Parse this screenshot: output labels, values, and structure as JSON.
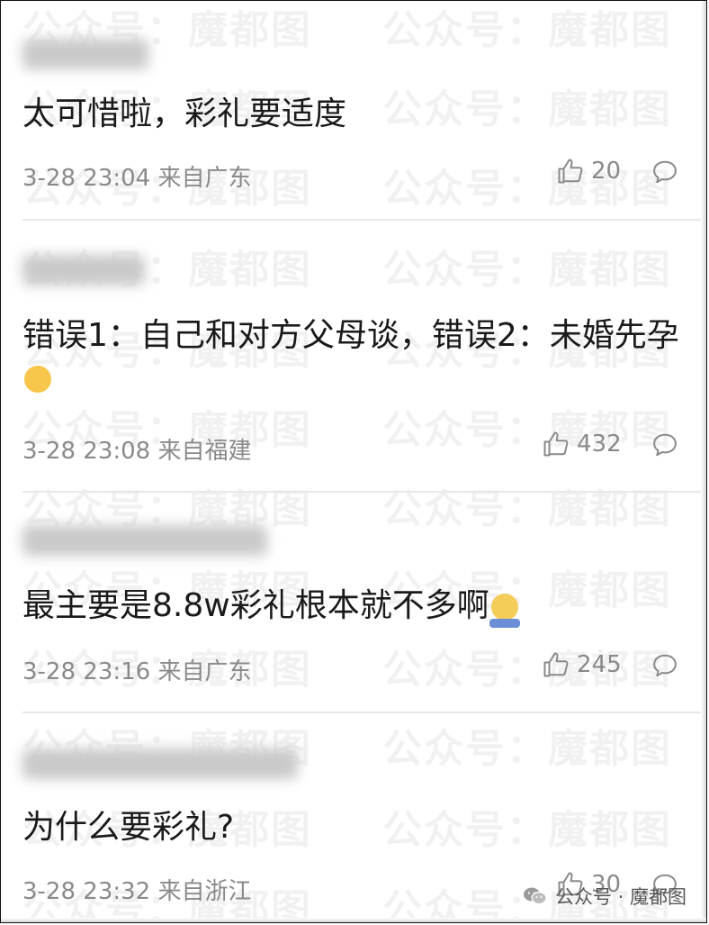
{
  "watermark": "公众号：魔都图",
  "comments": [
    {
      "text": "太可惜啦，彩礼要适度",
      "meta": "3-28 23:04 来自广东",
      "likes": "20"
    },
    {
      "text": "错误1：自己和对方父母谈，错误2：未婚先孕",
      "meta": "3-28 23:08 来自福建",
      "likes": "432"
    },
    {
      "text": "最主要是8.8w彩礼根本就不多啊",
      "meta": "3-28 23:16 来自广东",
      "likes": "245"
    },
    {
      "text": "为什么要彩礼?",
      "meta": "3-28 23:32 来自浙江",
      "likes": "30"
    }
  ],
  "brand": {
    "label": "公众号 · 魔都图"
  }
}
